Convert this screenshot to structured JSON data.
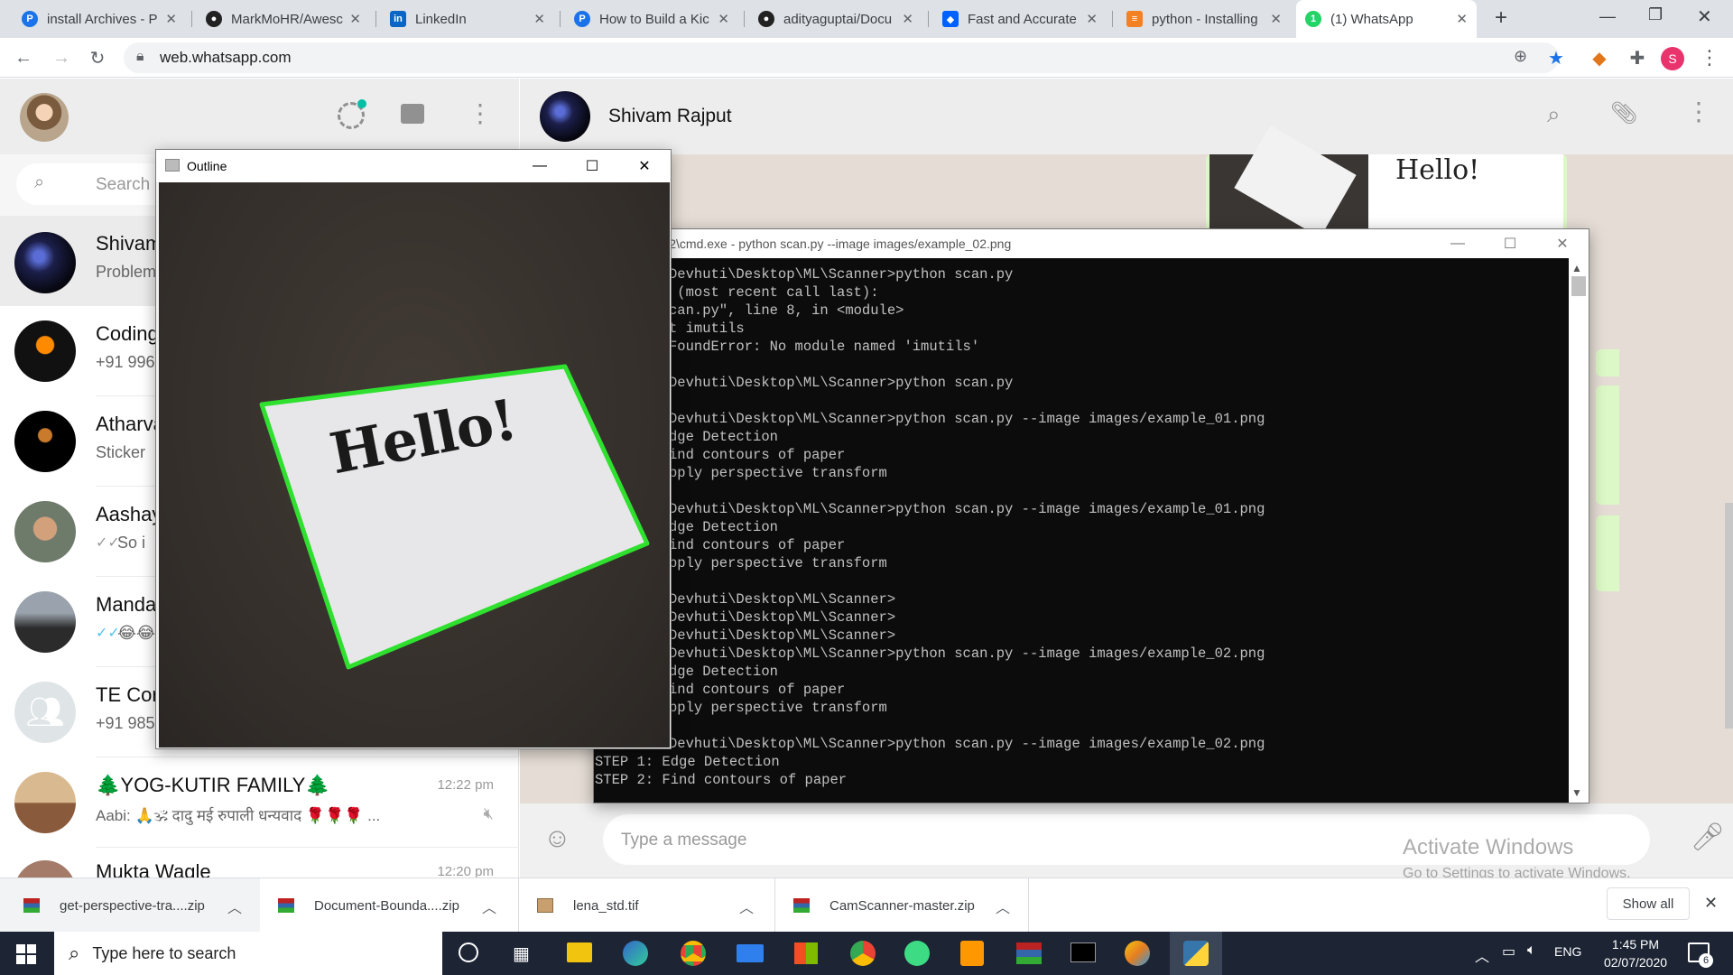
{
  "browser": {
    "tabs": [
      {
        "label": "install Archives - P",
        "icon": "p-blue-icon"
      },
      {
        "label": "MarkMoHR/Awesc",
        "icon": "github-icon"
      },
      {
        "label": "LinkedIn",
        "icon": "linkedin-icon"
      },
      {
        "label": "How to Build a Kic",
        "icon": "p-blue-icon"
      },
      {
        "label": "adityaguptai/Docu",
        "icon": "github-icon"
      },
      {
        "label": "Fast and Accurate",
        "icon": "dropbox-icon"
      },
      {
        "label": "python - Installing",
        "icon": "stackoverflow-icon"
      },
      {
        "label": "(1) WhatsApp",
        "icon": "whatsapp-icon",
        "active": true
      }
    ],
    "url": "web.whatsapp.com",
    "profile_letter": "S"
  },
  "whatsapp": {
    "search_placeholder": "Search or start new chat",
    "active_contact": "Shivam Rajput",
    "chats": [
      {
        "name": "Shivam Rajput",
        "preview": "Problem solved",
        "time": ""
      },
      {
        "name": "Coding Helix",
        "preview": "+91 9960",
        "time": ""
      },
      {
        "name": "Atharva",
        "preview": "Sticker",
        "time": ""
      },
      {
        "name": "Aashay",
        "preview": "So i",
        "time": ""
      },
      {
        "name": "Manda",
        "preview": "😂😂",
        "time": ""
      },
      {
        "name": "TE Cor",
        "preview": "+91 985",
        "time": ""
      },
      {
        "name": "🌲YOG-KUTIR FAMILY🌲",
        "preview": "Aabi: 🙏🕉 दादु मई रुपाली धन्यवाद 🌹🌹🌹 ...",
        "time": "12:22 pm"
      },
      {
        "name": "Mukta Wagle",
        "preview": "",
        "time": "12:20 pm"
      }
    ],
    "message_placeholder": "Type a message",
    "chat_image_text": "Hello!"
  },
  "outline_window": {
    "title": "Outline",
    "card_text": "Hello!"
  },
  "cmd_window": {
    "title": "ows\\System32\\cmd.exe - python  scan.py --image images/example_02.png",
    "lines": [
      "Devhuti\\Desktop\\ML\\Scanner>python scan.py",
      " (most recent call last):",
      "can.py\", line 8, in <module>",
      "t imutils",
      "FoundError: No module named 'imutils'",
      "",
      "Devhuti\\Desktop\\ML\\Scanner>python scan.py",
      "",
      "Devhuti\\Desktop\\ML\\Scanner>python scan.py --image images/example_01.png",
      "dge Detection",
      "ind contours of paper",
      "pply perspective transform",
      "",
      "Devhuti\\Desktop\\ML\\Scanner>python scan.py --image images/example_01.png",
      "dge Detection",
      "ind contours of paper",
      "pply perspective transform",
      "",
      "Devhuti\\Desktop\\ML\\Scanner>",
      "Devhuti\\Desktop\\ML\\Scanner>",
      "Devhuti\\Desktop\\ML\\Scanner>",
      "Devhuti\\Desktop\\ML\\Scanner>python scan.py --image images/example_02.png",
      "dge Detection",
      "ind contours of paper",
      "pply perspective transform",
      "",
      "Devhuti\\Desktop\\ML\\Scanner>python scan.py --image images/example_02.png"
    ],
    "full_lines": [
      "STEP 1: Edge Detection",
      "STEP 2: Find contours of paper"
    ]
  },
  "activate_windows": {
    "title": "Activate Windows",
    "subtitle": "Go to Settings to activate Windows."
  },
  "downloads": {
    "items": [
      {
        "label": "get-perspective-tra....zip",
        "icon": "zip-icon"
      },
      {
        "label": "Document-Bounda....zip",
        "icon": "zip-icon"
      },
      {
        "label": "lena_std.tif",
        "icon": "image-file-icon"
      },
      {
        "label": "CamScanner-master.zip",
        "icon": "zip-icon"
      }
    ],
    "show_all": "Show all"
  },
  "taskbar": {
    "search_placeholder": "Type here to search",
    "language": "ENG",
    "time": "1:45 PM",
    "date": "02/07/2020",
    "notification_count": "6"
  },
  "colors": {
    "whatsapp_green": "#00bfa5",
    "outline_green": "#2fe02f",
    "taskbar": "#1d2535"
  }
}
